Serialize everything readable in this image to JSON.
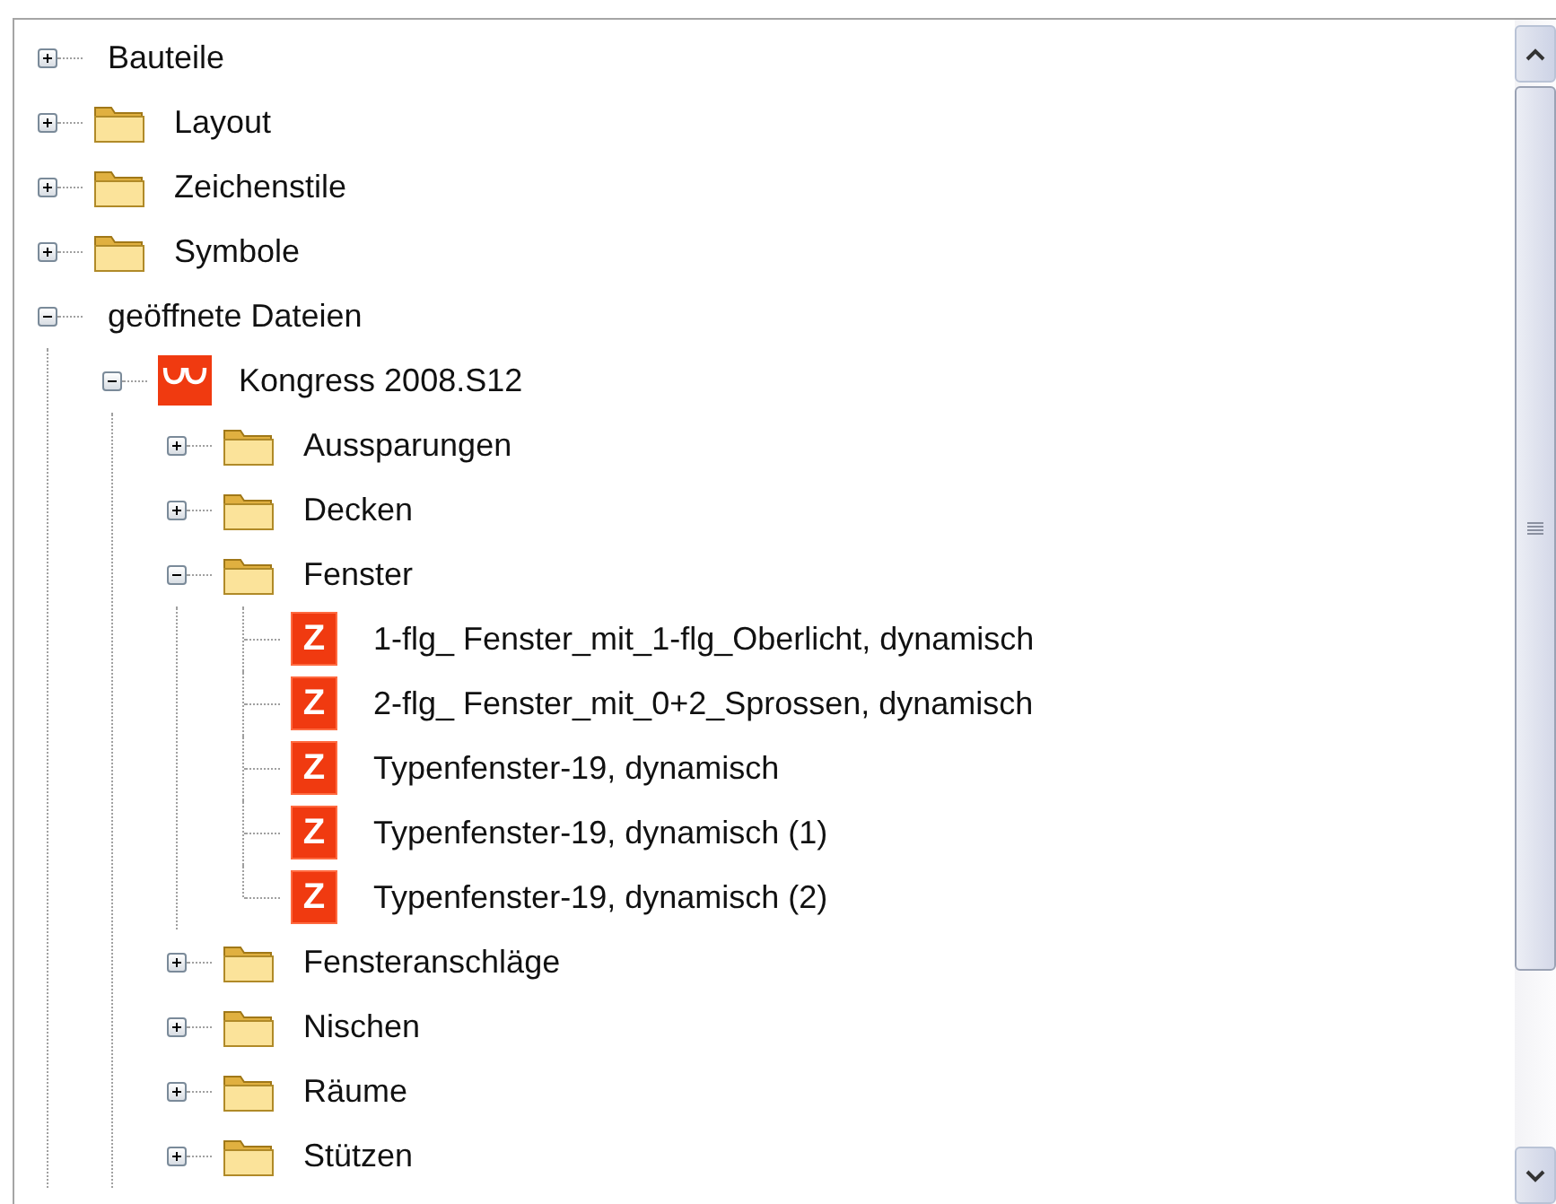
{
  "tree": [
    {
      "kind": "plain",
      "label": "Bauteile",
      "expanded": false
    },
    {
      "kind": "folder",
      "label": "Layout",
      "expanded": false
    },
    {
      "kind": "folder",
      "label": "Zeichenstile",
      "expanded": false
    },
    {
      "kind": "folder",
      "label": "Symbole",
      "expanded": false
    },
    {
      "kind": "plain",
      "label": "geöffnete Dateien",
      "expanded": true,
      "children": [
        {
          "kind": "project",
          "label": "Kongress 2008.S12",
          "expanded": true,
          "children": [
            {
              "kind": "folder",
              "label": "Aussparungen",
              "expanded": false
            },
            {
              "kind": "folder",
              "label": "Decken",
              "expanded": false
            },
            {
              "kind": "folder",
              "label": "Fenster",
              "expanded": true,
              "children": [
                {
                  "kind": "file",
                  "badge": "Z",
                  "label": "1-flg_ Fenster_mit_1-flg_Oberlicht, dynamisch"
                },
                {
                  "kind": "file",
                  "badge": "Z",
                  "label": "2-flg_ Fenster_mit_0+2_Sprossen, dynamisch"
                },
                {
                  "kind": "file",
                  "badge": "Z",
                  "label": "Typenfenster-19, dynamisch"
                },
                {
                  "kind": "file",
                  "badge": "Z",
                  "label": "Typenfenster-19, dynamisch (1)"
                },
                {
                  "kind": "file",
                  "badge": "Z",
                  "label": "Typenfenster-19, dynamisch (2)"
                }
              ]
            },
            {
              "kind": "folder",
              "label": "Fensteranschläge",
              "expanded": false
            },
            {
              "kind": "folder",
              "label": "Nischen",
              "expanded": false
            },
            {
              "kind": "folder",
              "label": "Räume",
              "expanded": false
            },
            {
              "kind": "folder",
              "label": "Stützen",
              "expanded": false
            }
          ]
        }
      ]
    }
  ]
}
